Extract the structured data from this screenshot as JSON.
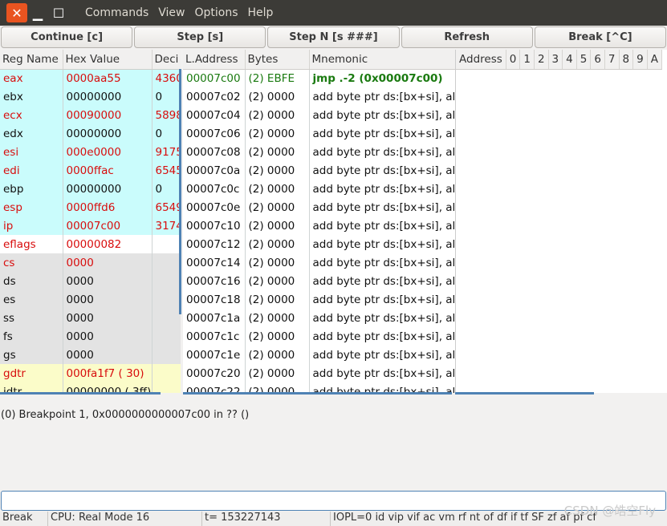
{
  "window": {
    "close_icon": "close-icon",
    "minimize_icon": "minimize-icon",
    "maximize_icon": "maximize-icon"
  },
  "menu": [
    "Commands",
    "View",
    "Options",
    "Help"
  ],
  "toolbar": [
    "Continue [c]",
    "Step [s]",
    "Step N [s ###]",
    "Refresh",
    "Break [^C]"
  ],
  "registers": {
    "headers": [
      "Reg Name",
      "Hex Value",
      "Deci"
    ],
    "rows": [
      {
        "name": "eax",
        "hex": "0000aa55",
        "dec": "4360",
        "changed": true,
        "group": "cyan"
      },
      {
        "name": "ebx",
        "hex": "00000000",
        "dec": "0",
        "changed": false,
        "group": "cyan"
      },
      {
        "name": "ecx",
        "hex": "00090000",
        "dec": "5898",
        "changed": true,
        "group": "cyan"
      },
      {
        "name": "edx",
        "hex": "00000000",
        "dec": "0",
        "changed": false,
        "group": "cyan"
      },
      {
        "name": "esi",
        "hex": "000e0000",
        "dec": "9175",
        "changed": true,
        "group": "cyan"
      },
      {
        "name": "edi",
        "hex": "0000ffac",
        "dec": "6545",
        "changed": true,
        "group": "cyan"
      },
      {
        "name": "ebp",
        "hex": "00000000",
        "dec": "0",
        "changed": false,
        "group": "cyan"
      },
      {
        "name": "esp",
        "hex": "0000ffd6",
        "dec": "6549",
        "changed": true,
        "group": "cyan"
      },
      {
        "name": "ip",
        "hex": "00007c00",
        "dec": "3174",
        "changed": true,
        "group": "cyan"
      },
      {
        "name": "eflags",
        "hex": "00000082",
        "dec": "",
        "changed": true,
        "group": "white"
      },
      {
        "name": "cs",
        "hex": "0000",
        "dec": "",
        "changed": true,
        "group": "gray"
      },
      {
        "name": "ds",
        "hex": "0000",
        "dec": "",
        "changed": false,
        "group": "gray"
      },
      {
        "name": "es",
        "hex": "0000",
        "dec": "",
        "changed": false,
        "group": "gray"
      },
      {
        "name": "ss",
        "hex": "0000",
        "dec": "",
        "changed": false,
        "group": "gray"
      },
      {
        "name": "fs",
        "hex": "0000",
        "dec": "",
        "changed": false,
        "group": "gray"
      },
      {
        "name": "gs",
        "hex": "0000",
        "dec": "",
        "changed": false,
        "group": "gray"
      },
      {
        "name": "gdtr",
        "hex": "000fa1f7 ( 30)",
        "dec": "",
        "changed": true,
        "group": "yellow"
      },
      {
        "name": "idtr",
        "hex": "00000000 ( 3ff)",
        "dec": "",
        "changed": false,
        "group": "yellow"
      }
    ]
  },
  "disasm": {
    "headers": [
      "L.Address",
      "Bytes",
      "Mnemonic"
    ],
    "rows": [
      {
        "addr": "00007c00",
        "bytes": "(2) EBFE",
        "mn": "jmp .-2 (0x00007c00)",
        "current": true
      },
      {
        "addr": "00007c02",
        "bytes": "(2) 0000",
        "mn": "add byte ptr ds:[bx+si], al"
      },
      {
        "addr": "00007c04",
        "bytes": "(2) 0000",
        "mn": "add byte ptr ds:[bx+si], al"
      },
      {
        "addr": "00007c06",
        "bytes": "(2) 0000",
        "mn": "add byte ptr ds:[bx+si], al"
      },
      {
        "addr": "00007c08",
        "bytes": "(2) 0000",
        "mn": "add byte ptr ds:[bx+si], al"
      },
      {
        "addr": "00007c0a",
        "bytes": "(2) 0000",
        "mn": "add byte ptr ds:[bx+si], al"
      },
      {
        "addr": "00007c0c",
        "bytes": "(2) 0000",
        "mn": "add byte ptr ds:[bx+si], al"
      },
      {
        "addr": "00007c0e",
        "bytes": "(2) 0000",
        "mn": "add byte ptr ds:[bx+si], al"
      },
      {
        "addr": "00007c10",
        "bytes": "(2) 0000",
        "mn": "add byte ptr ds:[bx+si], al"
      },
      {
        "addr": "00007c12",
        "bytes": "(2) 0000",
        "mn": "add byte ptr ds:[bx+si], al"
      },
      {
        "addr": "00007c14",
        "bytes": "(2) 0000",
        "mn": "add byte ptr ds:[bx+si], al"
      },
      {
        "addr": "00007c16",
        "bytes": "(2) 0000",
        "mn": "add byte ptr ds:[bx+si], al"
      },
      {
        "addr": "00007c18",
        "bytes": "(2) 0000",
        "mn": "add byte ptr ds:[bx+si], al"
      },
      {
        "addr": "00007c1a",
        "bytes": "(2) 0000",
        "mn": "add byte ptr ds:[bx+si], al"
      },
      {
        "addr": "00007c1c",
        "bytes": "(2) 0000",
        "mn": "add byte ptr ds:[bx+si], al"
      },
      {
        "addr": "00007c1e",
        "bytes": "(2) 0000",
        "mn": "add byte ptr ds:[bx+si], al"
      },
      {
        "addr": "00007c20",
        "bytes": "(2) 0000",
        "mn": "add byte ptr ds:[bx+si], al"
      },
      {
        "addr": "00007c22",
        "bytes": "(2) 0000",
        "mn": "add byte ptr ds:[bx+si], al"
      }
    ]
  },
  "memory": {
    "headers": [
      "Address",
      "0",
      "1",
      "2",
      "3",
      "4",
      "5",
      "6",
      "7",
      "8",
      "9",
      "A"
    ]
  },
  "output": "(0) Breakpoint 1, 0x0000000000007c00 in ?? ()",
  "command_input": "",
  "status": {
    "state": "Break",
    "cpu": "CPU: Real Mode 16",
    "ticks": "t= 153227143",
    "flags": "IOPL=0 id vip vif ac vm rf nt of df if tf SF zf af pf cf"
  },
  "watermark": "CSDN @皓空Fly",
  "colors": {
    "changed": "#d80d0d",
    "current": "#1a7a10",
    "accent": "#e95420"
  }
}
